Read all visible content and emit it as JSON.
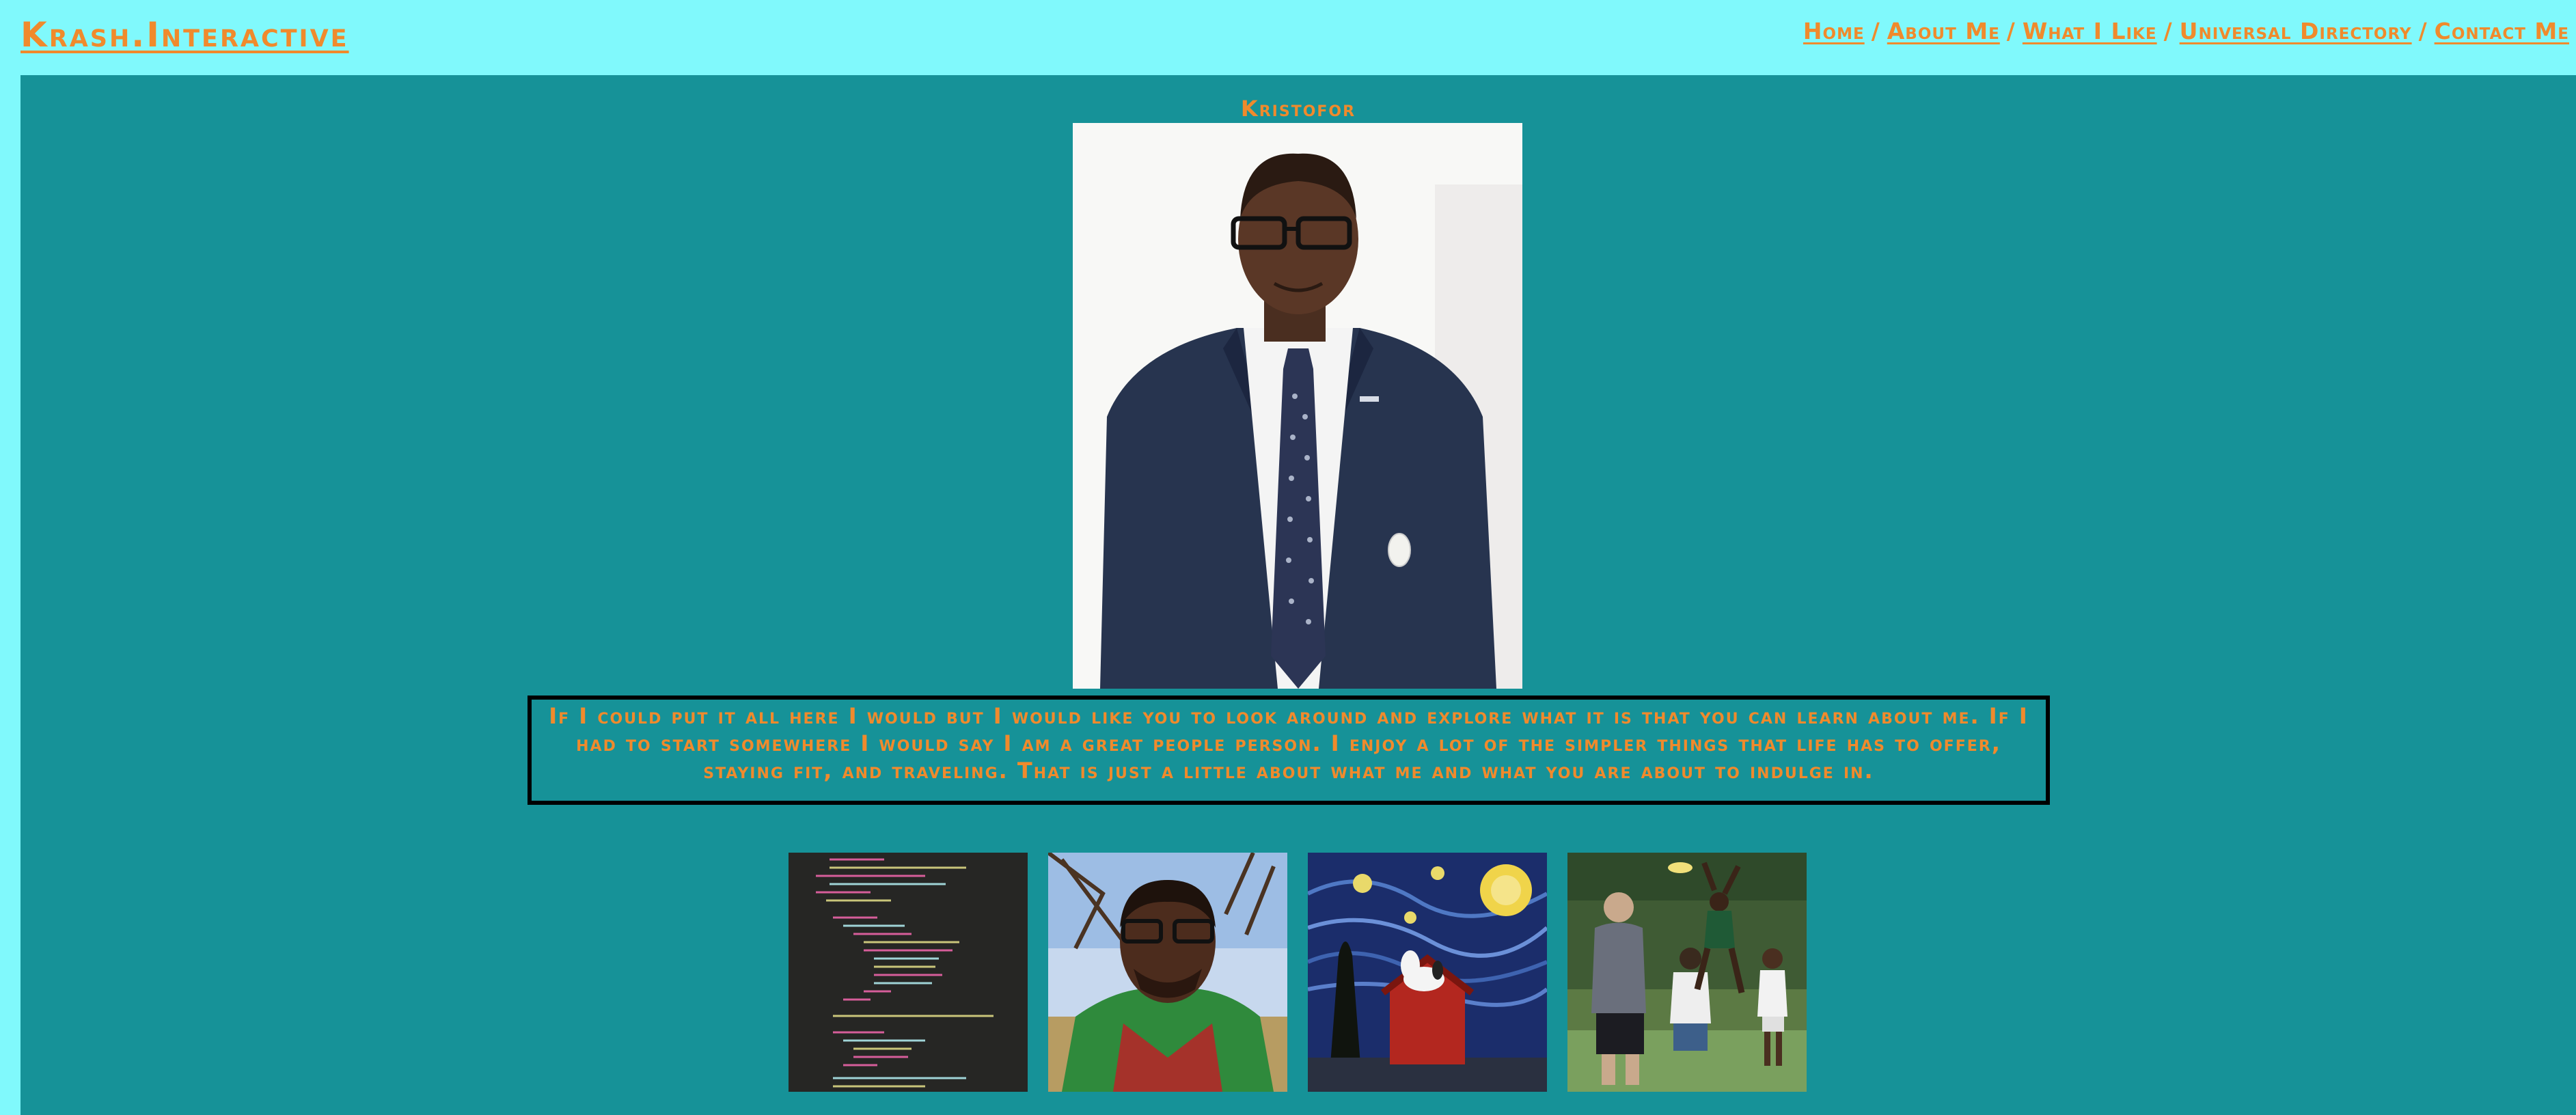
{
  "header": {
    "brand": "Krash.Interactive",
    "nav": [
      {
        "label": "Home"
      },
      {
        "label": "About Me"
      },
      {
        "label": "What I Like"
      },
      {
        "label": "Universal Directory"
      },
      {
        "label": "Contact Me"
      }
    ],
    "separator": "/"
  },
  "main": {
    "name": "Kristofor",
    "bio": "If I could put it all here I would but I would like you to look around and explore what it is that you can learn about me. If I had to start somewhere I would say I am a great people person. I enjoy a lot of the simpler things that life has to offer, staying fit, and traveling. That is just a little about what me and what you are about to indulge in.",
    "gallery": [
      {
        "icon": "code-screenshot"
      },
      {
        "icon": "selfie-photo"
      },
      {
        "icon": "starry-night-snoopy-painting"
      },
      {
        "icon": "frisbee-game-photo"
      }
    ]
  },
  "colors": {
    "header_bg": "#80f9fc",
    "main_bg": "#169298",
    "accent": "#f08a2c",
    "border": "#000000"
  }
}
